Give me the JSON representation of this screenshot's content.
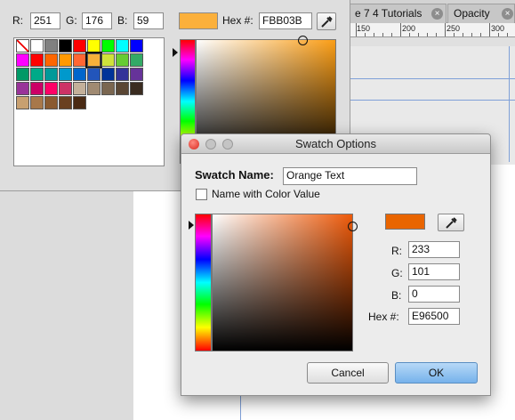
{
  "document": {
    "tabs": [
      {
        "label": "e 7 4 Tutorials"
      },
      {
        "label": "Opacity"
      }
    ],
    "ruler_labels": [
      "150",
      "200",
      "250",
      "300",
      "35"
    ]
  },
  "color_panel": {
    "r_label": "R:",
    "r_value": "251",
    "g_label": "G:",
    "g_value": "176",
    "b_label": "B:",
    "b_value": "59",
    "hex_label": "Hex #:",
    "hex_value": "FBB03B",
    "current_color": "#fbb03b",
    "swatches": [
      [
        "none",
        "#ffffff",
        "#808080",
        "#000000",
        "#ff0000",
        "#ffff00",
        "#00ff00",
        "#00ffff",
        "#0000ff"
      ],
      [
        "#ff00ff",
        "#ff0000",
        "#ff6600",
        "#ff9900",
        "#ff6633",
        "#f7b13a",
        "#cfe23a",
        "#66cc33",
        "#33aa66"
      ],
      [
        "#009966",
        "#00aa88",
        "#009999",
        "#0099cc",
        "#0066cc",
        "#2255bb",
        "#003399",
        "#333399",
        "#663399"
      ],
      [
        "#993399",
        "#cc0066",
        "#ff0066",
        "#cc3366",
        "#c4b09a",
        "#a08a72",
        "#7a6650",
        "#5a4634",
        "#3a2c20"
      ],
      [
        "#c8a070",
        "#a8784a",
        "#8a5a30",
        "#6a4020",
        "#4a2a14"
      ]
    ]
  },
  "dialog": {
    "title": "Swatch Options",
    "swatch_name_label": "Swatch Name:",
    "swatch_name_value": "Orange Text",
    "name_with_color_label": "Name with Color Value",
    "name_with_color_checked": false,
    "color": "#e96500",
    "r_label": "R:",
    "r_value": "233",
    "g_label": "G:",
    "g_value": "101",
    "b_label": "B:",
    "b_value": "0",
    "hex_label": "Hex #:",
    "hex_value": "E96500",
    "cancel_label": "Cancel",
    "ok_label": "OK"
  }
}
